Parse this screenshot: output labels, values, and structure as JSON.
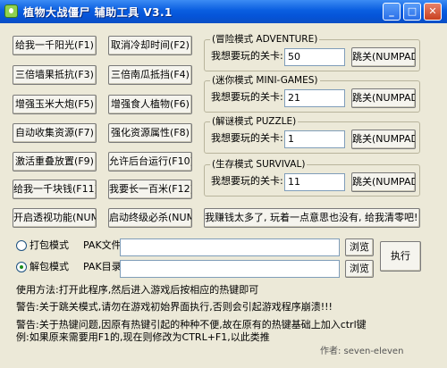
{
  "window": {
    "title": "植物大战僵尸  辅助工具  V3.1",
    "min_glyph": "_",
    "max_glyph": "□",
    "close_glyph": "✕"
  },
  "left_buttons": {
    "give_sun": "给我一千阳光(F1)",
    "cancel_cooldown": "取消冷却时间(F2)",
    "triple_wall": "三倍墙果抵抗(F3)",
    "triple_pumpkin": "三倍南瓜抵挡(F4)",
    "boost_corn": "增强玉米大炮(F5)",
    "boost_chomper": "增强食人植物(F6)",
    "auto_collect": "自动收集资源(F7)",
    "boost_resources": "强化资源属性(F8)",
    "free_place": "激活重叠放置(F9)",
    "background_run": "允许后台运行(F10)",
    "give_money": "给我一千块钱(F11)",
    "grow_tall": "我要长一百米(F12)",
    "xray": "开启透视功能(NUM9)",
    "ultimate": "启动终级必杀(NUM0)"
  },
  "modes": {
    "adventure": {
      "legend": "(冒险模式 ADVENTURE)",
      "label": "我想要玩的关卡:",
      "value": "50",
      "button": "跳关(NUMPAD1)"
    },
    "minigames": {
      "legend": "(迷你模式 MINI-GAMES)",
      "label": "我想要玩的关卡:",
      "value": "21",
      "button": "跳关(NUMPAD2)"
    },
    "puzzle": {
      "legend": "(解谜模式 PUZZLE)",
      "label": "我想要玩的关卡:",
      "value": "1",
      "button": "跳关(NUMPAD3)"
    },
    "survival": {
      "legend": "(生存模式 SURVIVAL)",
      "label": "我想要玩的关卡:",
      "value": "11",
      "button": "跳关(NUMPAD4)"
    }
  },
  "reset_money": "我赚钱太多了, 玩着一点意思也没有, 给我清零吧!!!",
  "pak": {
    "pack_mode": "打包模式",
    "unpack_mode": "解包模式",
    "selected": "unpack",
    "file_label": "PAK文件:",
    "dir_label": "PAK目录:",
    "file_value": "",
    "dir_value": "",
    "browse": "浏览",
    "execute": "执行"
  },
  "notes": {
    "usage": "使用方法:打开此程序,然后进入游戏后按相应的热键即可",
    "warning1": "警告:关于跳关模式,请勿在游戏初始界面执行,否则会引起游戏程序崩溃!!!",
    "warning2_line1": "警告:关于热键问题,因原有热键引起的种种不便,故在原有的热键基础上加入ctrl键",
    "warning2_line2": "例:如果原来需要用F1的,现在则修改为CTRL+F1,以此类推"
  },
  "author": "作者:  seven-eleven"
}
